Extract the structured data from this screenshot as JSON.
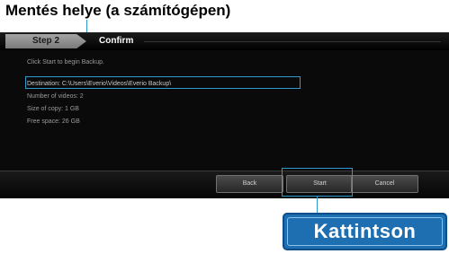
{
  "annotation": {
    "title": "Mentés helye (a számítógépen)",
    "callout_label": "Kattintson"
  },
  "wizard": {
    "step_label": "Step 2",
    "step_title": "Confirm",
    "lines": {
      "intro": "Click Start to begin Backup.",
      "destination": "Destination: C:\\Users\\Everio\\Videos\\Everio Backup\\",
      "line3": "Number of videos: 2",
      "line4": "Size of copy: 1 GB",
      "line5": "Free space: 26 GB"
    },
    "buttons": {
      "back": "Back",
      "start": "Start",
      "cancel": "Cancel"
    }
  },
  "colors": {
    "accent": "#2f9ad0",
    "callout_fill": "#1d6fb2"
  }
}
